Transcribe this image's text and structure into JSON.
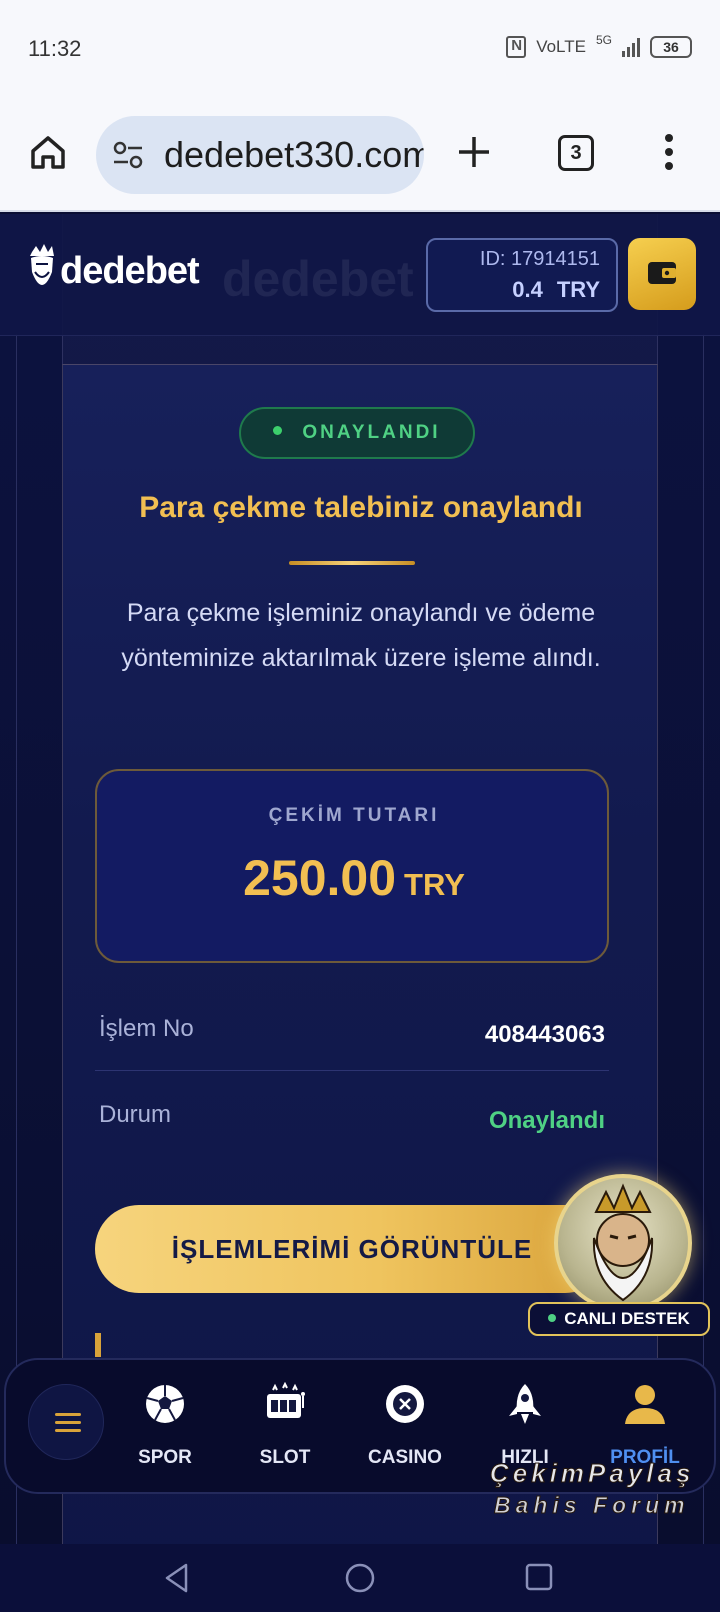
{
  "status_bar": {
    "time": "11:32",
    "network_label": "VoLTE",
    "network_type": "5G",
    "battery": "36"
  },
  "browser": {
    "url": "dedebet330.com",
    "tab_count": "3"
  },
  "header": {
    "brand": "dedebet",
    "account_id": "ID: 17914151",
    "balance_amount": "0.4",
    "balance_currency": "TRY"
  },
  "card": {
    "status_badge": "ONAYLANDI",
    "title": "Para çekme talebiniz onaylandı",
    "description": "Para çekme işleminiz onaylandı ve ödeme yönteminize aktarılmak üzere işleme alındı.",
    "amount_label": "ÇEKİM TUTARI",
    "amount_value": "250.00",
    "amount_currency": "TRY",
    "details": [
      {
        "label": "İşlem No",
        "value": "408443063"
      },
      {
        "label": "Durum",
        "value": "Onaylandı"
      }
    ],
    "action_button": "İŞLEMLERİMİ GÖRÜNTÜLE"
  },
  "support": {
    "label": "CANLI DESTEK"
  },
  "bottom_nav": {
    "items": [
      {
        "label": "SPOR",
        "icon": "soccer-ball-icon"
      },
      {
        "label": "SLOT",
        "icon": "slot-machine-icon"
      },
      {
        "label": "CASINO",
        "icon": "casino-chip-icon"
      },
      {
        "label": "HIZLI",
        "icon": "rocket-icon"
      },
      {
        "label": "PROFİL",
        "icon": "user-icon"
      }
    ]
  },
  "watermark": {
    "line1": "ÇekimPaylaş",
    "line2": "Bahis Forum"
  },
  "colors": {
    "background": "#0b1036",
    "gold_accent": "#f2bf52",
    "success_green": "#4fd184",
    "active_nav": "#4f8ff0"
  }
}
